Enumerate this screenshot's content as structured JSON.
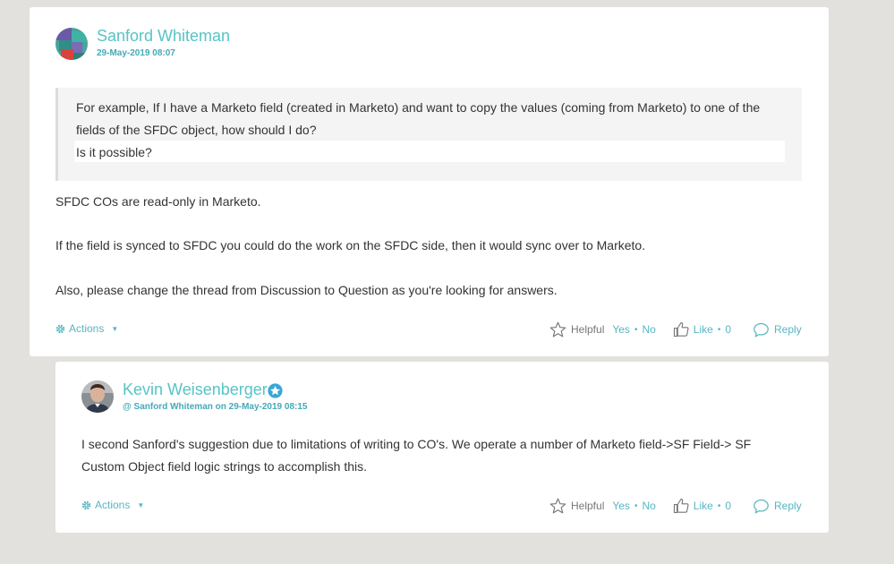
{
  "posts": [
    {
      "author": "Sanford Whiteman",
      "date": "29-May-2019 08:07",
      "quote": {
        "line1": "For example, If I have a Marketo field (created in Marketo) and want to copy the values (coming from Marketo) to one of the",
        "line2": "fields of the SFDC object, how should I do?",
        "line3": "Is it possible?"
      },
      "paragraphs": [
        "SFDC COs are read-only in Marketo.",
        "If the field is synced to SFDC you could do the work on the SFDC side, then it would sync over to Marketo.",
        "Also, please change the thread from Discussion to Question as you're looking for answers."
      ],
      "actions_label": "Actions",
      "helpful_label": "Helpful",
      "yes_label": "Yes",
      "no_label": "No",
      "like_label": "Like",
      "like_count": "0",
      "reply_label": "Reply"
    },
    {
      "author": "Kevin Weisenberger",
      "reply_to": "@ Sanford Whiteman on 29-May-2019 08:15",
      "paragraph_lines": [
        "I second Sanford's suggestion due to limitations of writing to CO's. We operate a number of Marketo field->SF Field-> SF",
        "Custom Object field logic strings to accomplish this."
      ],
      "actions_label": "Actions",
      "helpful_label": "Helpful",
      "yes_label": "Yes",
      "no_label": "No",
      "like_label": "Like",
      "like_count": "0",
      "reply_label": "Reply"
    }
  ],
  "colors": {
    "accent": "#58c3c6",
    "link": "#58b6c2",
    "background": "#e2e1dd"
  }
}
